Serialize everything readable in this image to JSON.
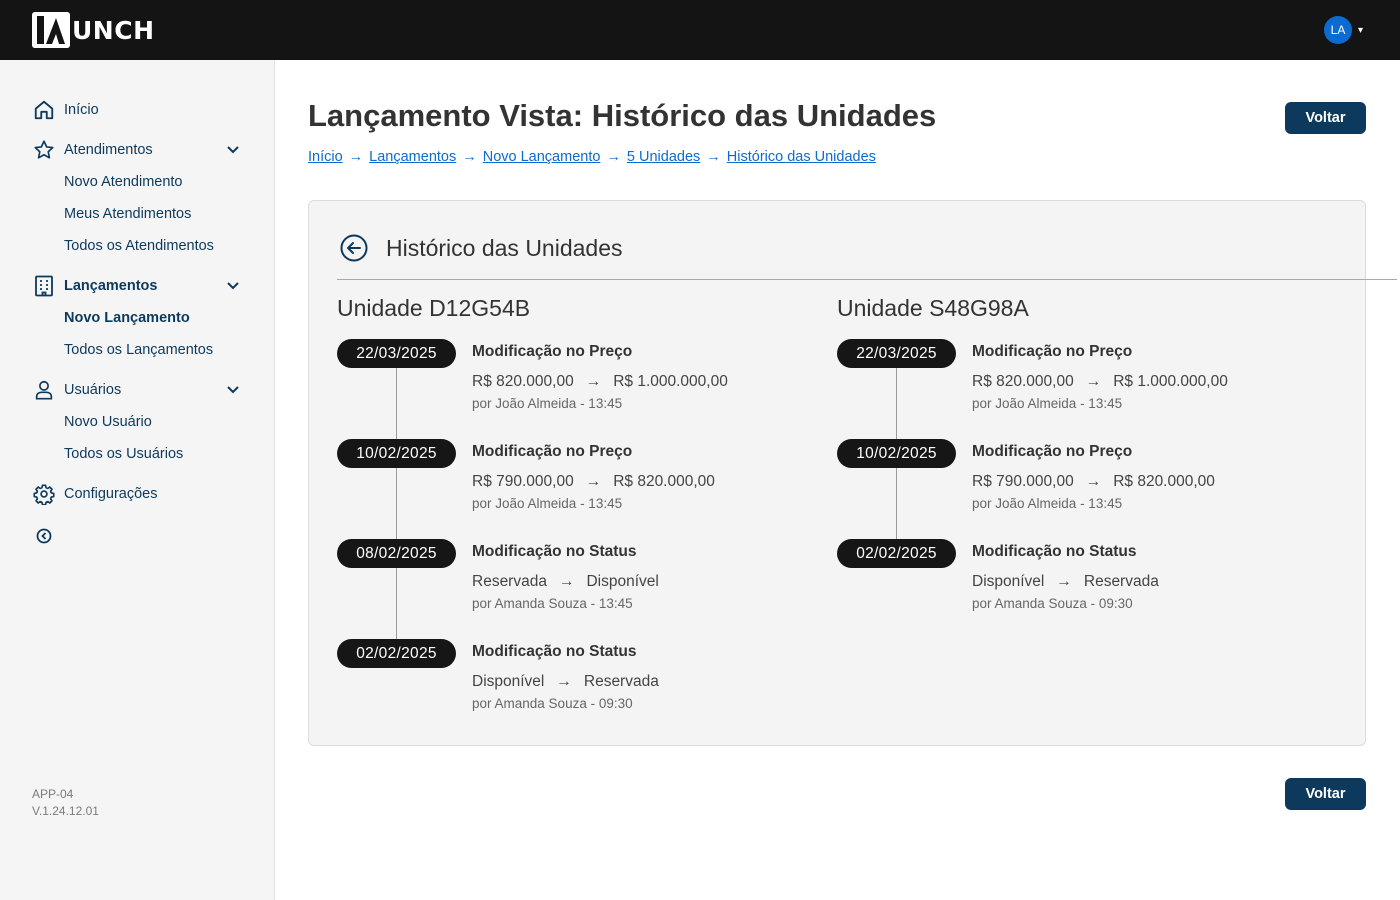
{
  "header": {
    "logo_text": "UNCH",
    "user_initials": "LA"
  },
  "sidebar": {
    "home": "Início",
    "atendimentos": {
      "label": "Atendimentos",
      "items": [
        "Novo Atendimento",
        "Meus Atendimentos",
        "Todos os Atendimentos"
      ]
    },
    "lancamentos": {
      "label": "Lançamentos",
      "items": [
        "Novo Lançamento",
        "Todos os Lançamentos"
      ]
    },
    "usuarios": {
      "label": "Usuários",
      "items": [
        "Novo Usuário",
        "Todos os Usuários"
      ]
    },
    "configuracoes": "Configurações",
    "app_code": "APP-04",
    "version": "V.1.24.12.01"
  },
  "page": {
    "title_bold": "Lançamento Vista:",
    "title_rest": "Histórico das Unidades",
    "back_label": "Voltar",
    "breadcrumb": [
      "Início",
      "Lançamentos",
      "Novo Lançamento",
      "5 Unidades",
      "Histórico das Unidades"
    ],
    "breadcrumb_sep": "→"
  },
  "panel": {
    "title": "Histórico das Unidades",
    "arrow": "→",
    "units": [
      {
        "name": "Unidade D12G54B",
        "entries": [
          {
            "date": "22/03/2025",
            "title": "Modificação no Preço",
            "from": "R$ 820.000,00",
            "to": "R$ 1.000.000,00",
            "meta": "por João Almeida - 13:45"
          },
          {
            "date": "10/02/2025",
            "title": "Modificação no Preço",
            "from": "R$ 790.000,00",
            "to": "R$ 820.000,00",
            "meta": "por João Almeida - 13:45"
          },
          {
            "date": "08/02/2025",
            "title": "Modificação no Status",
            "from": "Reservada",
            "to": "Disponível",
            "meta": "por Amanda Souza - 13:45"
          },
          {
            "date": "02/02/2025",
            "title": "Modificação no Status",
            "from": "Disponível",
            "to": "Reservada",
            "meta": "por Amanda Souza - 09:30"
          }
        ]
      },
      {
        "name": "Unidade S48G98A",
        "entries": [
          {
            "date": "22/03/2025",
            "title": "Modificação no Preço",
            "from": "R$ 820.000,00",
            "to": "R$ 1.000.000,00",
            "meta": "por João Almeida - 13:45"
          },
          {
            "date": "10/02/2025",
            "title": "Modificação no Preço",
            "from": "R$ 790.000,00",
            "to": "R$ 820.000,00",
            "meta": "por João Almeida - 13:45"
          },
          {
            "date": "02/02/2025",
            "title": "Modificação no Status",
            "from": "Disponível",
            "to": "Reservada",
            "meta": "por Amanda Souza - 09:30"
          }
        ]
      }
    ]
  },
  "icons": {
    "home": "home-icon",
    "atendimentos": "star-icon",
    "lancamentos": "building-icon",
    "usuarios": "user-icon",
    "configuracoes": "gear-icon",
    "collapse": "circle-arrow-left-icon",
    "back": "circle-arrow-left-icon"
  },
  "colors": {
    "primary": "#0d3a5c",
    "link": "#0c6bd1",
    "topbar": "#141414",
    "avatar": "#0c6bd1",
    "pill": "#161616"
  }
}
